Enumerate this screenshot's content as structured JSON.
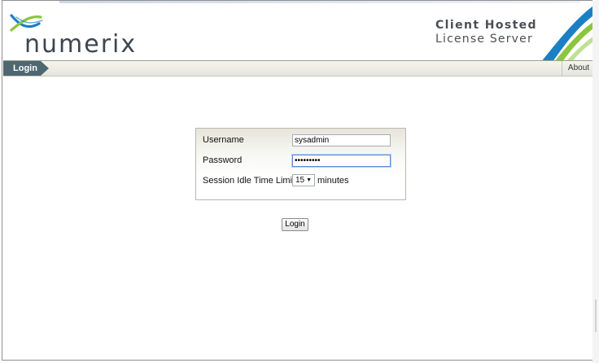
{
  "brand": {
    "logo_text": "numerix",
    "product_line1": "Client Hosted",
    "product_line2": "License Server"
  },
  "nav": {
    "active_tab": "Login",
    "about_link": "About"
  },
  "form": {
    "username_label": "Username",
    "username_value": "sysadmin",
    "password_label": "Password",
    "password_value": "•••••••••",
    "session_label": "Session Idle Time Limit",
    "session_value": "15",
    "session_unit": "minutes",
    "submit_label": "Login"
  },
  "colors": {
    "tab_bg": "#4e6770",
    "logo_blue": "#1b7fc4",
    "logo_green": "#8cc63e",
    "logo_text": "#3d4650"
  },
  "icons": {
    "dropdown": "chevron-down-icon"
  }
}
